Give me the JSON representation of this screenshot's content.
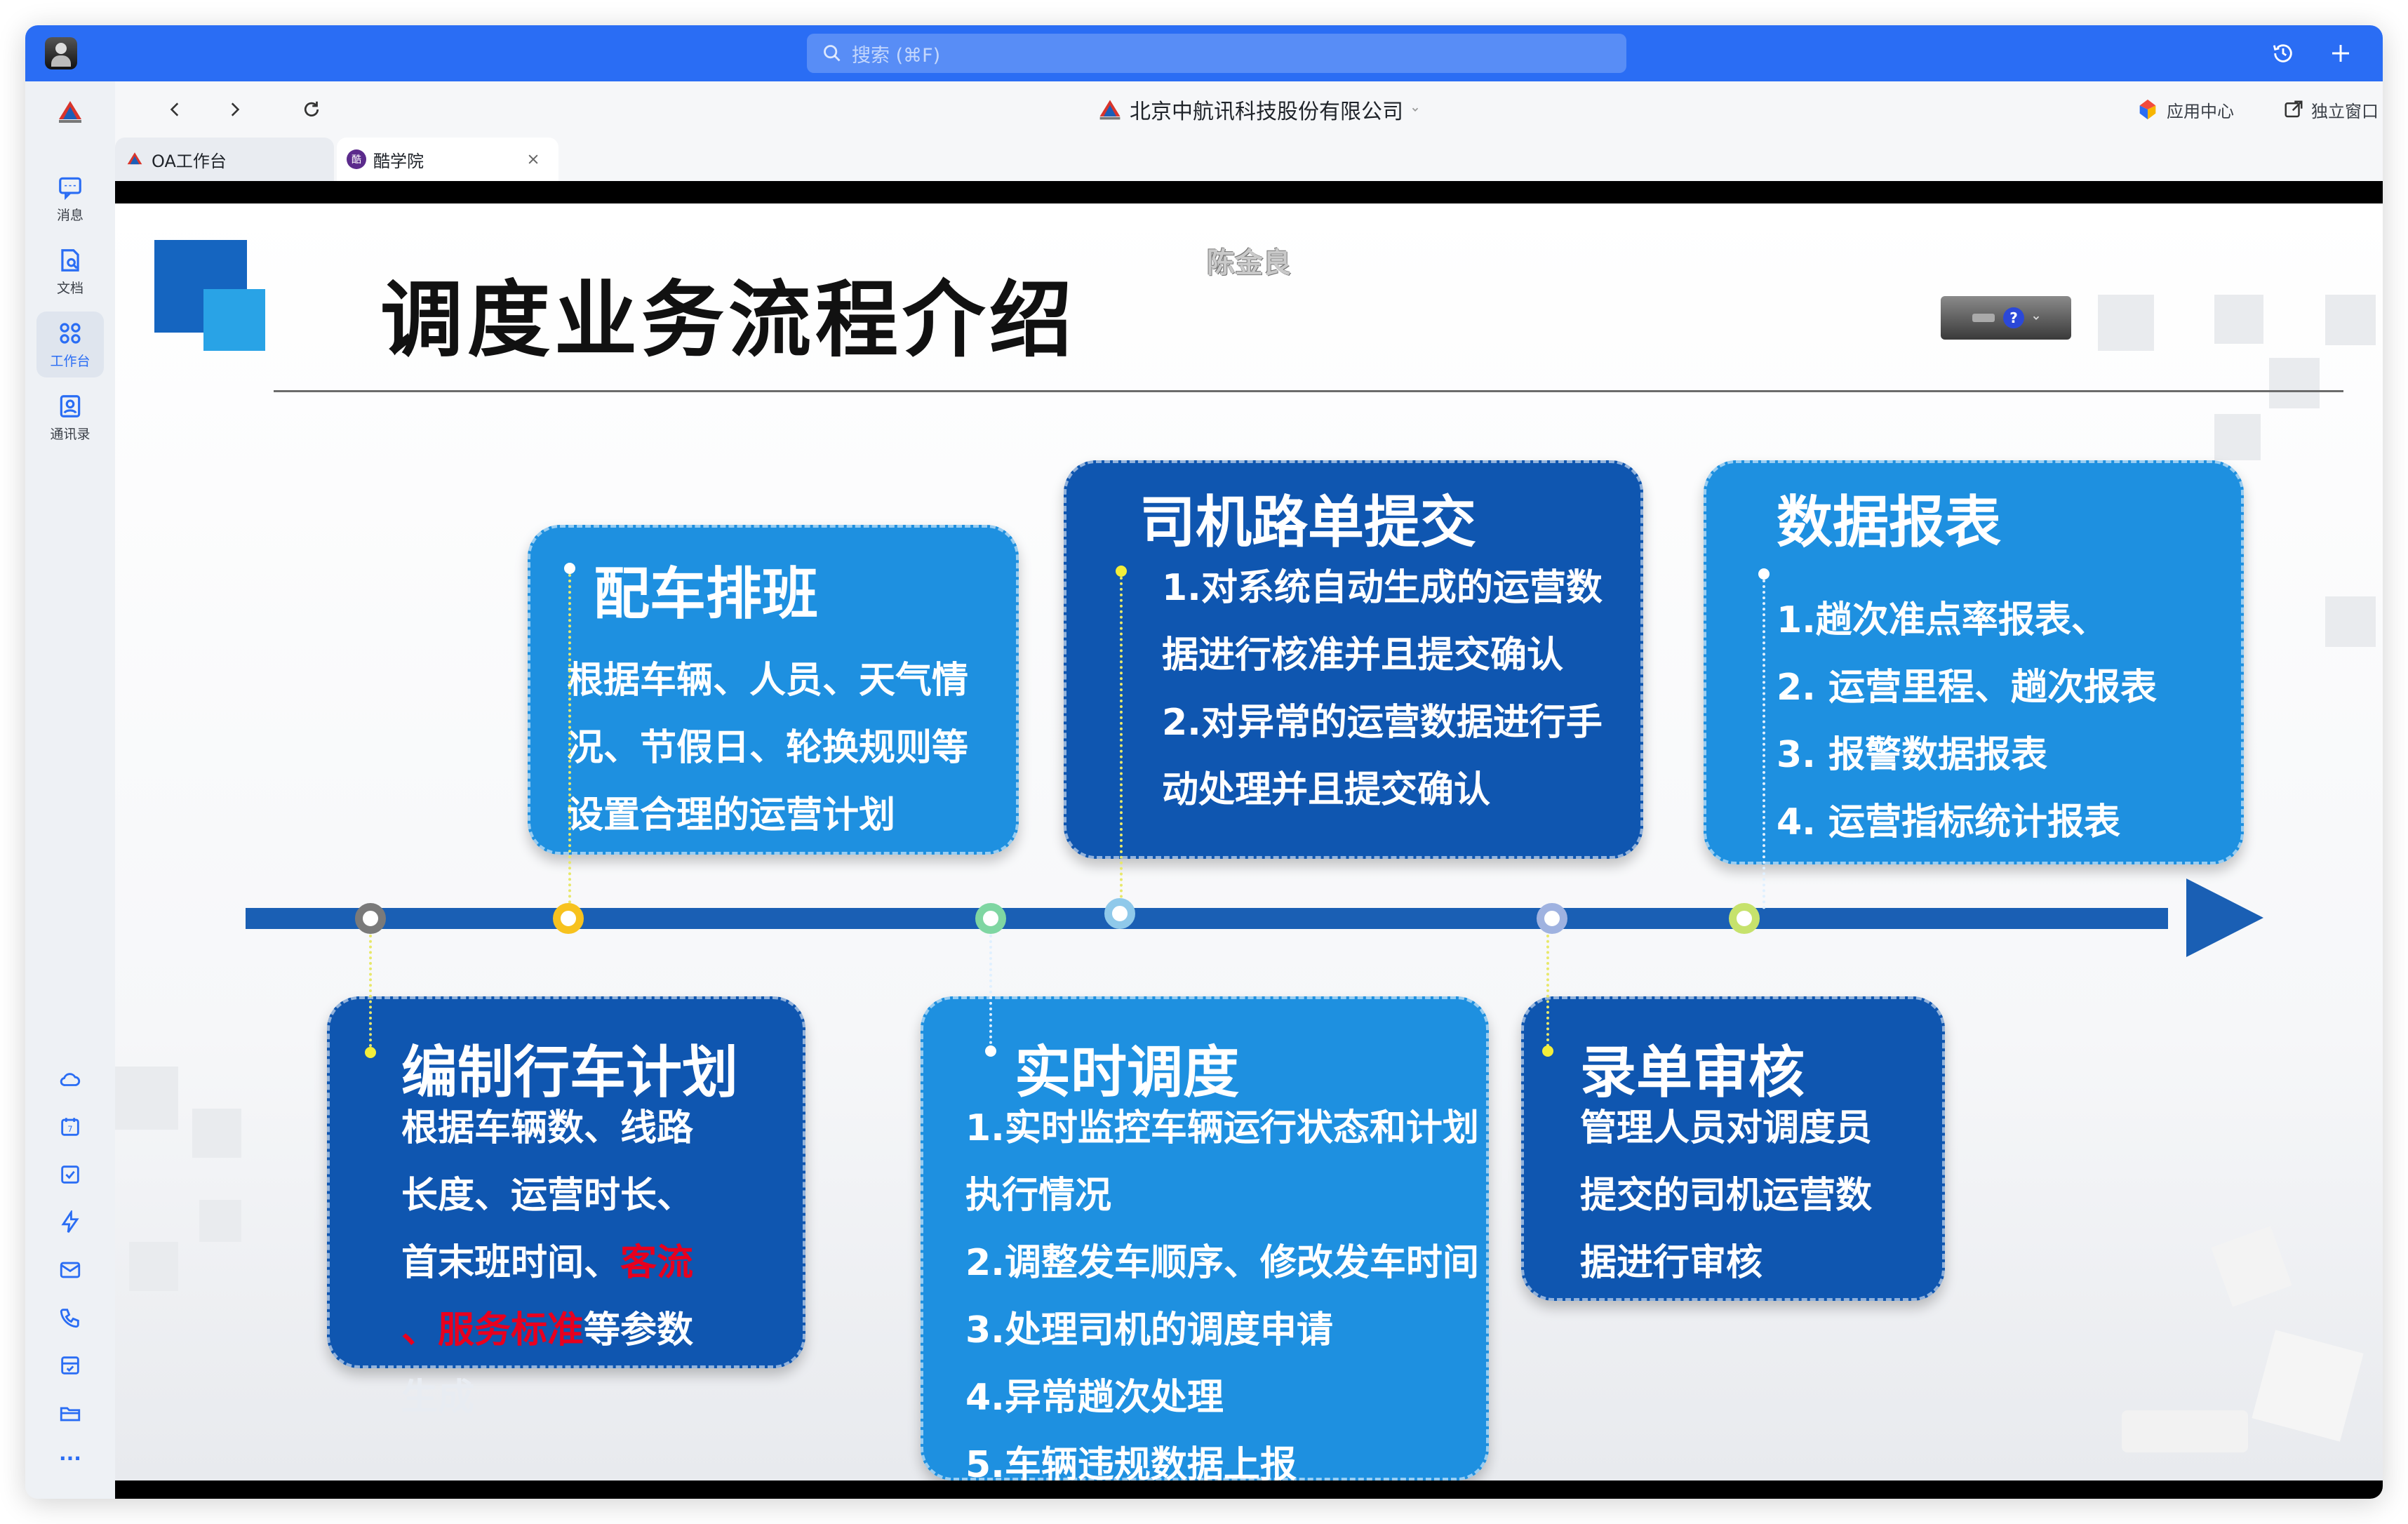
{
  "app": {
    "search_placeholder": "搜索 (⌘F)",
    "site_title": "北京中航讯科技股份有限公司",
    "app_center": "应用中心",
    "standalone_window": "独立窗口"
  },
  "sidebar": {
    "items": [
      {
        "label": "消息",
        "icon": "message-icon"
      },
      {
        "label": "文档",
        "icon": "document-icon"
      },
      {
        "label": "工作台",
        "icon": "workbench-icon"
      },
      {
        "label": "通讯录",
        "icon": "contacts-icon"
      }
    ],
    "bottom_icons": [
      "cloud-icon",
      "calendar-icon",
      "todo-icon",
      "lightning-icon",
      "mail-icon",
      "phone-icon",
      "approval-icon",
      "folder-icon",
      "more-icon"
    ],
    "more_label": "···"
  },
  "tabs": [
    {
      "label": "OA工作台",
      "active": false
    },
    {
      "label": "酷学院",
      "active": true
    }
  ],
  "slide": {
    "title": "调度业务流程介绍",
    "author": "陈金良",
    "cards": {
      "peiche": {
        "title": "配车排班",
        "lines": [
          "根据车辆、人员、天气情",
          "况、节假日、轮换规则等",
          "设置合理的运营计划"
        ]
      },
      "siji": {
        "title": "司机路单提交",
        "lines": [
          "1.对系统自动生成的运营数",
          "据进行核准并且提交确认",
          "2.对异常的运营数据进行手",
          "动处理并且提交确认"
        ]
      },
      "shuju": {
        "title": "数据报表",
        "lines": [
          "1.趟次准点率报表、",
          "2. 运营里程、趟次报表",
          "3. 报警数据报表",
          "4. 运营指标统计报表"
        ]
      },
      "bianzhi": {
        "title": "编制行车计划",
        "line1": "根据车辆数、线路",
        "line2": "长度、运营时长、",
        "line3_a": "首末班时间、",
        "line3_red": "客流",
        "line4_red": "、服务标准",
        "line4_b": "等参数",
        "line5": "生成"
      },
      "shishi": {
        "title": "实时调度",
        "lines": [
          "1.实时监控车辆运行状态和计划",
          "执行情况",
          "2.调整发车顺序、修改发车时间",
          "3.处理司机的调度申请",
          "4.异常趟次处理",
          "5.车辆违规数据上报"
        ]
      },
      "ludan": {
        "title": "录单审核",
        "lines": [
          "管理人员对调度员",
          "提交的司机运营数",
          "据进行审核"
        ]
      }
    }
  },
  "colors": {
    "titlebar": "#2a6df4",
    "card_light": "#1e90e0",
    "card_dark": "#0f56b0",
    "timeline": "#1a5fb4",
    "highlight_red": "#e8001e"
  }
}
